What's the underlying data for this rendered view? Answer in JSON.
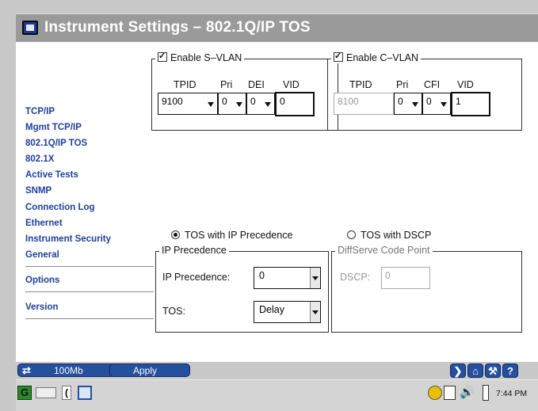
{
  "window": {
    "title": "Instrument Settings – 802.1Q/IP TOS"
  },
  "sidebar": {
    "items": [
      {
        "label": "TCP/IP"
      },
      {
        "label": "Mgmt TCP/IP"
      },
      {
        "label": "802.1Q/IP TOS"
      },
      {
        "label": "802.1X"
      },
      {
        "label": "Active Tests"
      },
      {
        "label": "SNMP"
      },
      {
        "label": "Connection Log"
      },
      {
        "label": "Ethernet"
      },
      {
        "label": "Instrument Security"
      },
      {
        "label": "General"
      },
      {
        "label": "Options"
      },
      {
        "label": "Version"
      }
    ]
  },
  "svlan": {
    "title": "Enable S–VLAN",
    "enabled": true,
    "tpid_label": "TPID",
    "pri_label": "Pri",
    "dei_label": "DEI",
    "vid_label": "VID",
    "tpid": "9100",
    "pri": "0",
    "dei": "0",
    "vid": "0"
  },
  "cvlan": {
    "title": "Enable C–VLAN",
    "enabled": true,
    "tpid_label": "TPID",
    "pri_label": "Pri",
    "cfi_label": "CFI",
    "vid_label": "VID",
    "tpid": "8100",
    "pri": "0",
    "cfi": "0",
    "vid": "1"
  },
  "tos": {
    "radio_precedence": "TOS with IP Precedence",
    "radio_dscp": "TOS with DSCP",
    "selected": "precedence",
    "precedence_group": "IP Precedence",
    "precedence_label": "IP Precedence:",
    "precedence_value": "0",
    "tos_label": "TOS:",
    "tos_value": "Delay",
    "dscp_group": "DiffServe Code Point",
    "dscp_label": "DSCP:",
    "dscp_value": "0"
  },
  "bottom": {
    "speed": "100Mb",
    "apply": "Apply"
  },
  "taskbar": {
    "time": "7:44 PM"
  },
  "colors": {
    "nav": "#1f3f9a",
    "button": "#24509e",
    "titlebar": "#9a9a9a"
  }
}
